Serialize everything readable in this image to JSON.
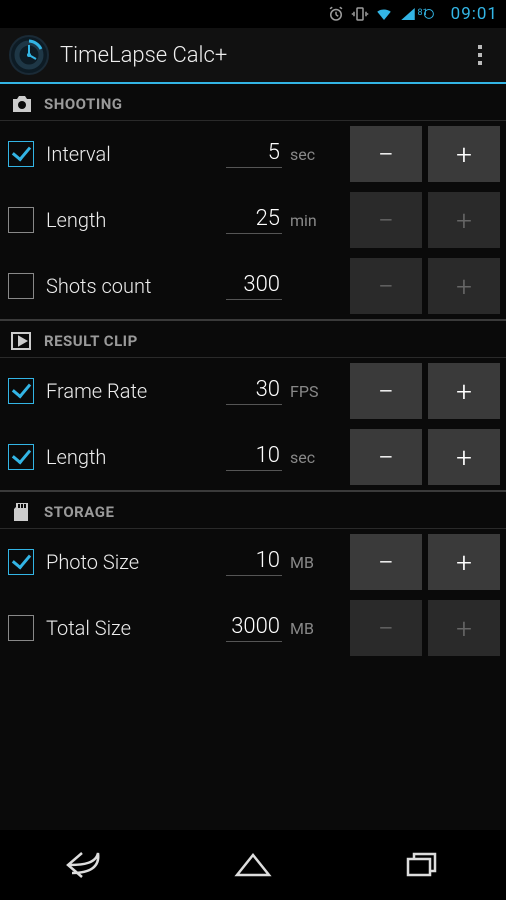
{
  "status_bar": {
    "battery_percent": "81",
    "time": "09:01"
  },
  "action_bar": {
    "title": "TimeLapse Calc+"
  },
  "sections": {
    "shooting": {
      "label": "SHOOTING",
      "rows": {
        "interval": {
          "label": "Interval",
          "value": "5",
          "unit": "sec",
          "checked": true
        },
        "length": {
          "label": "Length",
          "value": "25",
          "unit": "min",
          "checked": false
        },
        "shots": {
          "label": "Shots count",
          "value": "300",
          "unit": "",
          "checked": false
        }
      }
    },
    "result": {
      "label": "RESULT CLIP",
      "rows": {
        "framerate": {
          "label": "Frame Rate",
          "value": "30",
          "unit": "FPS",
          "checked": true
        },
        "length": {
          "label": "Length",
          "value": "10",
          "unit": "sec",
          "checked": true
        }
      }
    },
    "storage": {
      "label": "STORAGE",
      "rows": {
        "photosize": {
          "label": "Photo Size",
          "value": "10",
          "unit": "MB",
          "checked": true
        },
        "totalsize": {
          "label": "Total Size",
          "value": "3000",
          "unit": "MB",
          "checked": false
        }
      }
    }
  },
  "buttons": {
    "minus": "−",
    "plus": "+"
  }
}
